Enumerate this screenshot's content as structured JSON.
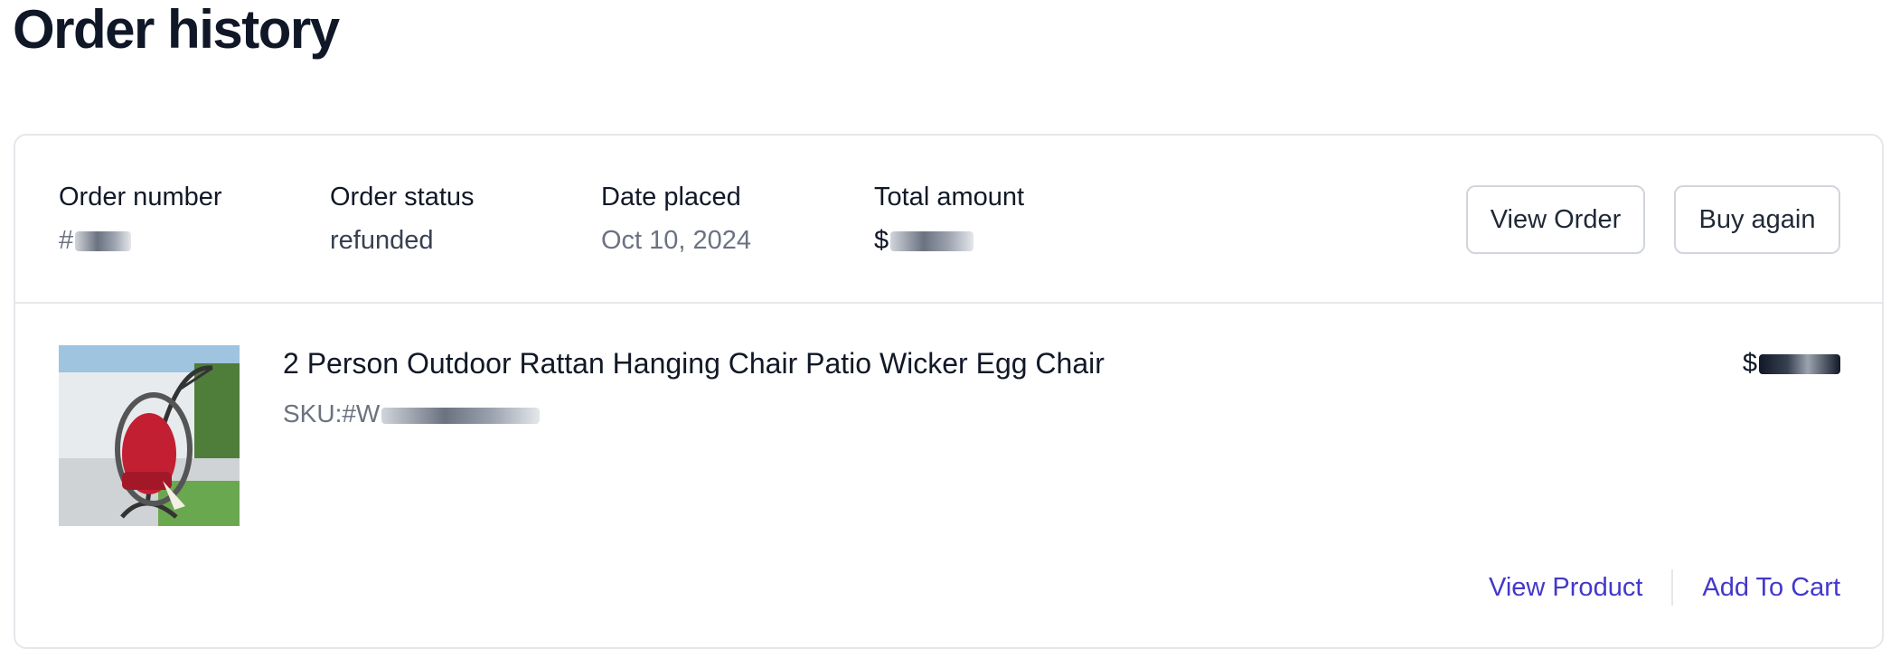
{
  "page": {
    "title": "Order history"
  },
  "order": {
    "number_label": "Order number",
    "number_value": "#",
    "status_label": "Order status",
    "status_value": "refunded",
    "date_label": "Date placed",
    "date_value": "Oct 10, 2024",
    "total_label": "Total amount",
    "total_value": "$",
    "view_order_label": "View Order",
    "buy_again_label": "Buy again"
  },
  "item": {
    "name": "2 Person Outdoor Rattan Hanging Chair Patio Wicker Egg Chair",
    "sku": "SKU:#W",
    "price": "$",
    "view_product_label": "View Product",
    "add_to_cart_label": "Add To Cart",
    "image_icon": "hanging-egg-chair-photo"
  },
  "colors": {
    "link": "#4338ca",
    "border": "#e5e7eb",
    "title": "#101828"
  }
}
